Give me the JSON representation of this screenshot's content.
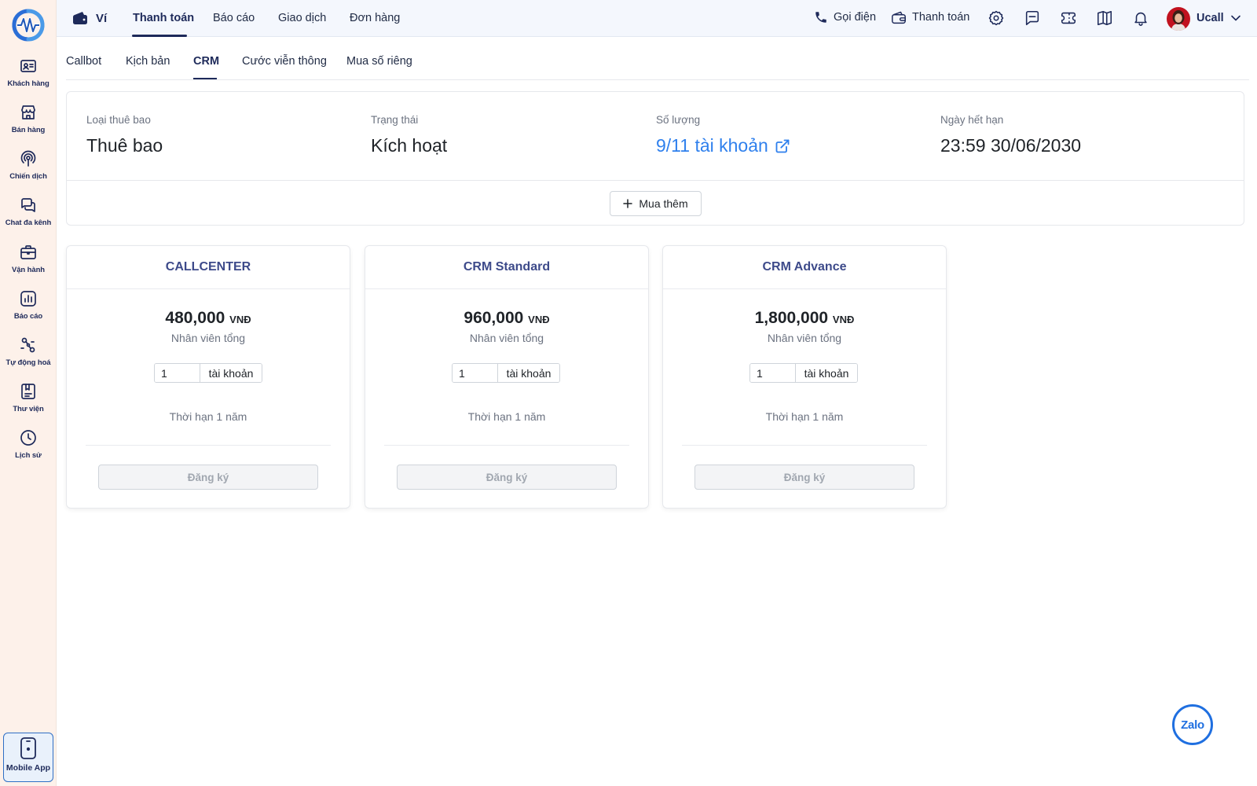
{
  "sidebar": {
    "logo_icon": "ucall-logo-icon",
    "items": [
      {
        "label": "Khách hàng",
        "icon": "contact-card-icon"
      },
      {
        "label": "Bán hàng",
        "icon": "store-icon"
      },
      {
        "label": "Chiến dịch",
        "icon": "broadcast-icon"
      },
      {
        "label": "Chat đa kênh",
        "icon": "chat-bubbles-icon"
      },
      {
        "label": "Vận hành",
        "icon": "briefcase-icon"
      },
      {
        "label": "Báo cáo",
        "icon": "bar-chart-icon"
      },
      {
        "label": "Tự động hoá",
        "icon": "workflow-icon"
      },
      {
        "label": "Thư viện",
        "icon": "bookmark-icon"
      },
      {
        "label": "Lịch sử",
        "icon": "clock-icon"
      }
    ],
    "mobile_app": {
      "label": "Mobile App",
      "icon": "mobile-phone-icon"
    }
  },
  "topbar": {
    "wallet_label": "Ví",
    "tabs": [
      "Thanh toán",
      "Báo cáo",
      "Giao dịch",
      "Đơn hàng"
    ],
    "active_tab": "Thanh toán",
    "call_label": "Gọi điện",
    "payment_label": "Thanh toán",
    "user_name": "Ucall"
  },
  "subtabs": {
    "items": [
      "Callbot",
      "Kịch bản",
      "CRM",
      "Cước viễn thông",
      "Mua số riêng"
    ],
    "active": "CRM"
  },
  "subscription": {
    "type_label": "Loại thuê bao",
    "type_value": "Thuê bao",
    "status_label": "Trạng thái",
    "status_value": "Kích hoạt",
    "quantity_label": "Số lượng",
    "quantity_value": "9/11 tài khoản",
    "expiry_label": "Ngày hết hạn",
    "expiry_value": "23:59 30/06/2030",
    "buy_more_label": "Mua thêm"
  },
  "plans": [
    {
      "title": "CALLCENTER",
      "price": "480,000",
      "currency": "VNĐ",
      "unit": "Nhân viên tổng",
      "qty": "1",
      "qty_unit": "tài khoản",
      "term": "Thời hạn 1 năm",
      "register_label": "Đăng ký"
    },
    {
      "title": "CRM Standard",
      "price": "960,000",
      "currency": "VNĐ",
      "unit": "Nhân viên tổng",
      "qty": "1",
      "qty_unit": "tài khoản",
      "term": "Thời hạn 1 năm",
      "register_label": "Đăng ký"
    },
    {
      "title": "CRM Advance",
      "price": "1,800,000",
      "currency": "VNĐ",
      "unit": "Nhân viên tổng",
      "qty": "1",
      "qty_unit": "tài khoản",
      "term": "Thời hạn 1 năm",
      "register_label": "Đăng ký"
    }
  ],
  "zalo_label": "Zalo",
  "colors": {
    "primary": "#1e2a5a",
    "link": "#2f80ed",
    "sidebar_bg": "#fdf1ea",
    "plan_title": "#3d4a8a",
    "zalo": "#1f6fe0"
  }
}
